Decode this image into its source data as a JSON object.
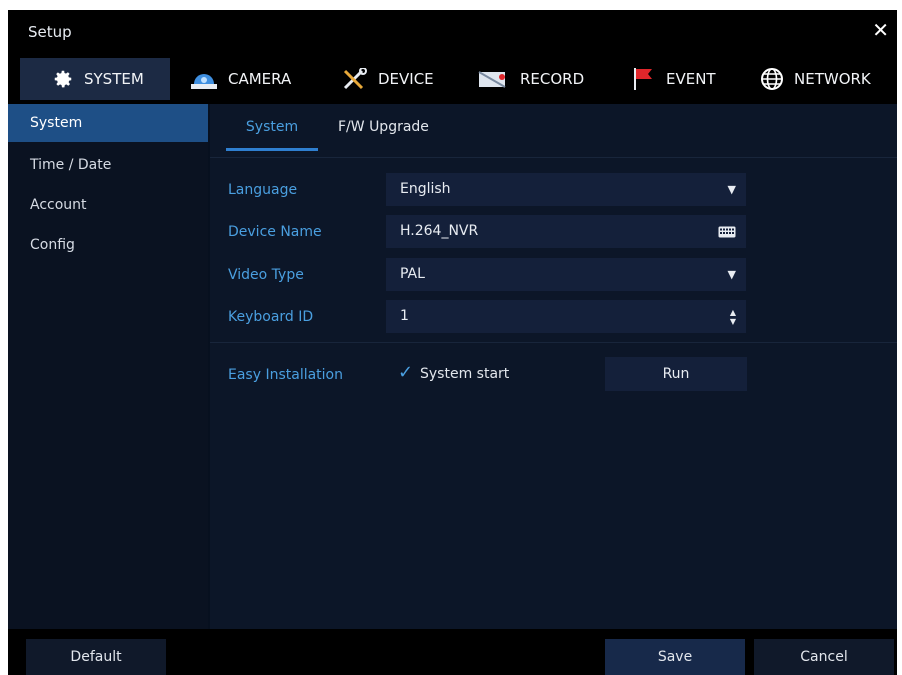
{
  "window": {
    "title": "Setup"
  },
  "tabs": [
    {
      "label": "SYSTEM",
      "icon": "gear-icon"
    },
    {
      "label": "CAMERA",
      "icon": "camera-icon"
    },
    {
      "label": "DEVICE",
      "icon": "tools-icon"
    },
    {
      "label": "RECORD",
      "icon": "record-icon"
    },
    {
      "label": "EVENT",
      "icon": "flag-icon"
    },
    {
      "label": "NETWORK",
      "icon": "globe-icon"
    }
  ],
  "sidebar": {
    "items": [
      {
        "label": "System"
      },
      {
        "label": "Time / Date"
      },
      {
        "label": "Account"
      },
      {
        "label": "Config"
      }
    ]
  },
  "subtabs": [
    {
      "label": "System"
    },
    {
      "label": "F/W Upgrade"
    }
  ],
  "form": {
    "language": {
      "label": "Language",
      "value": "English"
    },
    "device_name": {
      "label": "Device Name",
      "value": "H.264_NVR"
    },
    "video_type": {
      "label": "Video Type",
      "value": "PAL"
    },
    "keyboard_id": {
      "label": "Keyboard ID",
      "value": "1"
    },
    "easy_installation": {
      "label": "Easy Installation",
      "checkbox_label": "System start",
      "checked": true,
      "run_label": "Run"
    }
  },
  "footer": {
    "default_label": "Default",
    "save_label": "Save",
    "cancel_label": "Cancel"
  },
  "colors": {
    "accent": "#4a9fe0",
    "active_sidebar": "#1e4f86",
    "background": "#07101f"
  }
}
